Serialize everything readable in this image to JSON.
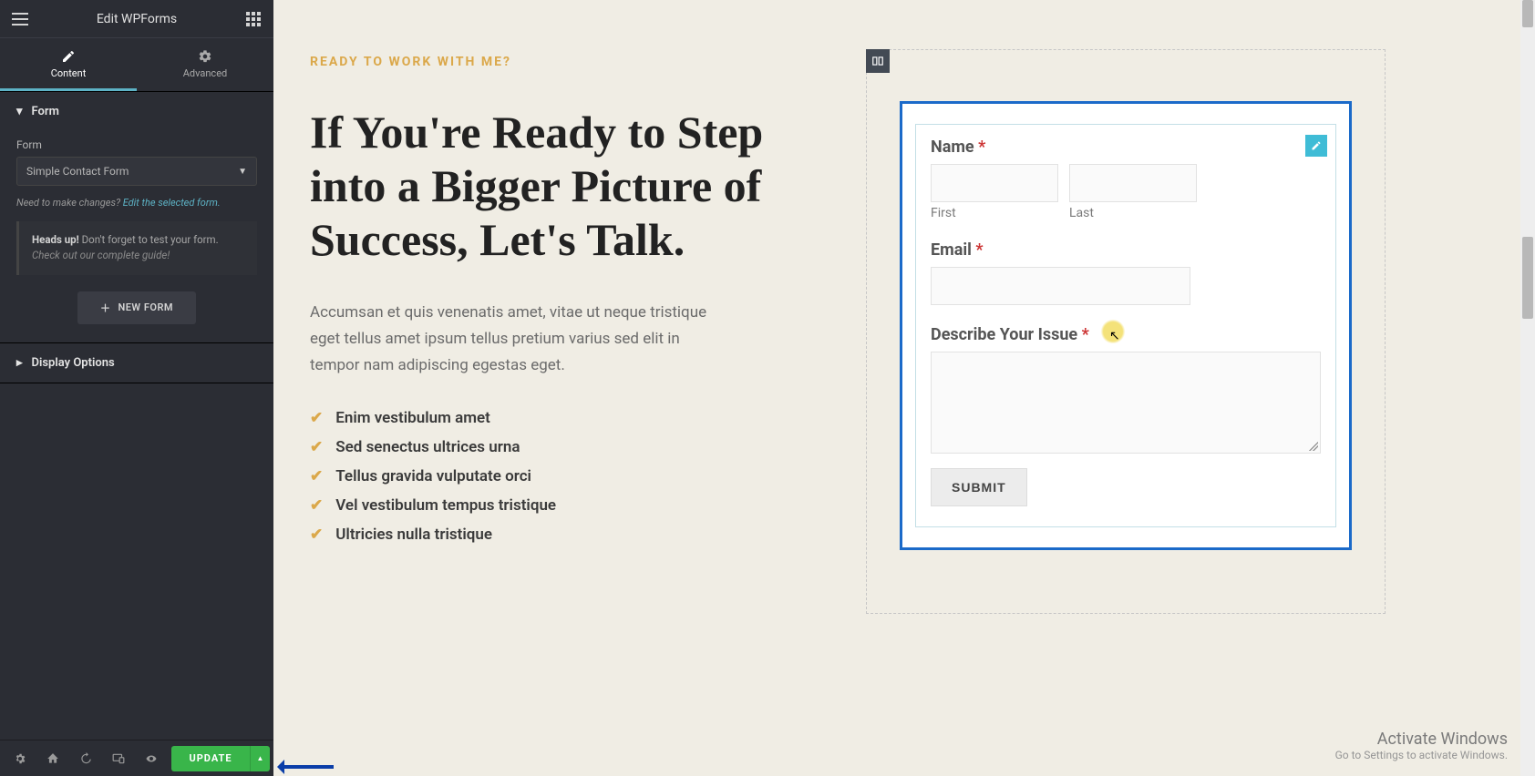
{
  "sidebar": {
    "title": "Edit WPForms",
    "tabs": {
      "content": "Content",
      "advanced": "Advanced"
    },
    "sections": {
      "form": {
        "title": "Form",
        "field_label": "Form",
        "select_value": "Simple Contact Form",
        "helper_prefix": "Need to make changes? ",
        "helper_link": "Edit the selected form.",
        "notice_strong": "Heads up!",
        "notice_text": " Don't forget to test your form.",
        "notice_em": "Check out our complete guide!",
        "new_form": "NEW FORM"
      },
      "display": {
        "title": "Display Options"
      }
    }
  },
  "footer": {
    "update": "UPDATE"
  },
  "content": {
    "eyebrow": "READY TO WORK WITH ME?",
    "headline": "If You're Ready to Step into a Bigger Picture of Success, Let's Talk.",
    "paragraph": "Accumsan et quis venenatis amet, vitae ut neque tristique eget tellus amet ipsum tellus pretium varius sed elit in tempor nam adipiscing egestas eget.",
    "items": [
      "Enim vestibulum amet",
      "Sed senectus ultrices urna",
      "Tellus gravida vulputate orci",
      "Vel vestibulum tempus tristique",
      "Ultricies nulla tristique"
    ]
  },
  "form": {
    "name_label": "Name",
    "first": "First",
    "last": "Last",
    "email_label": "Email",
    "desc_label": "Describe Your Issue",
    "submit": "SUBMIT",
    "required_mark": "*"
  },
  "watermark": {
    "line1": "Activate Windows",
    "line2": "Go to Settings to activate Windows."
  }
}
